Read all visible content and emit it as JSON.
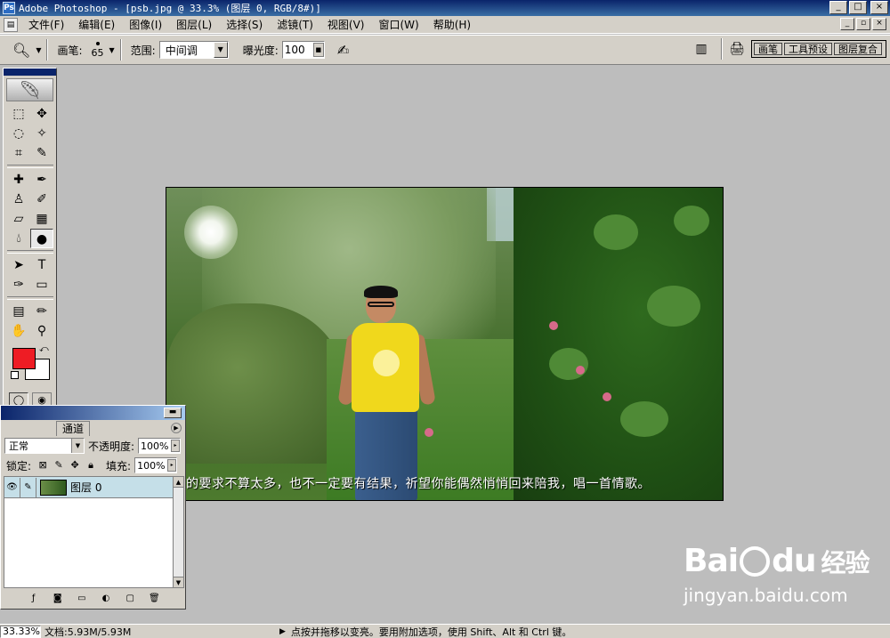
{
  "title_bar": {
    "title": "Adobe Photoshop - [psb.jpg @ 33.3% (图层 0, RGB/8#)]",
    "buttons": [
      "_",
      "□",
      "×"
    ]
  },
  "menu_bar": {
    "items": [
      "文件(F)",
      "编辑(E)",
      "图像(I)",
      "图层(L)",
      "选择(S)",
      "滤镜(T)",
      "视图(V)",
      "窗口(W)",
      "帮助(H)"
    ],
    "mdi_buttons": [
      "_",
      "▫",
      "×"
    ]
  },
  "options_bar": {
    "brush_label": "画笔:",
    "brush_size": "65",
    "range_label": "范围:",
    "range_value": "中间调",
    "exposure_label": "曝光度:",
    "exposure_value": "100",
    "palette_well_tabs": [
      "画笔",
      "工具预设",
      "图层复合"
    ]
  },
  "toolbox": {
    "colors": {
      "foreground": "#ee1c24",
      "background": "#ffffff"
    }
  },
  "canvas": {
    "caption": "的要求不算太多，也不一定要有结果，祈望你能偶然悄悄回来陪我，唱一首情歌。"
  },
  "layers_panel": {
    "tab_label": "通道",
    "blend_mode": "正常",
    "opacity_label": "不透明度:",
    "opacity_value": "100%",
    "lock_label": "锁定:",
    "fill_label": "填充:",
    "fill_value": "100%",
    "layers": [
      {
        "name": "图层 0"
      }
    ]
  },
  "status_bar": {
    "zoom": "33.33%",
    "doc_size": "文档:5.93M/5.93M",
    "hint": "点按并拖移以变亮。要用附加选项，使用 Shift、Alt 和 Ctrl 键。"
  },
  "watermark": {
    "logo_text_left": "Bai",
    "logo_text_right": "du",
    "logo_cn": "经验",
    "url": "jingyan.baidu.com"
  }
}
